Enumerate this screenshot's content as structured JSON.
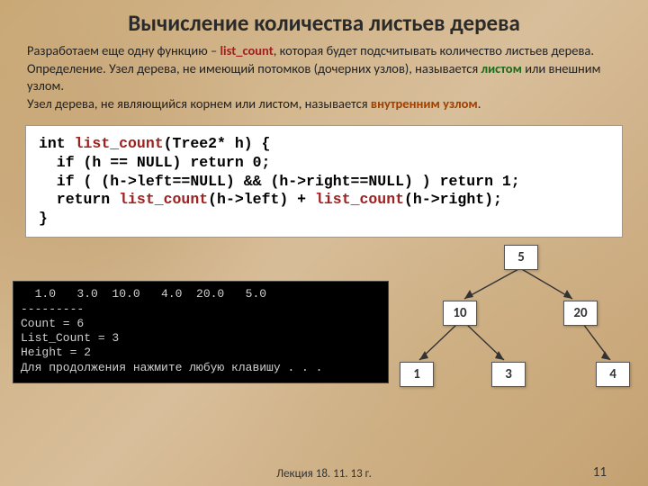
{
  "title": "Вычисление количества листьев дерева",
  "intro": {
    "p1a": "Разработаем еще одну функцию – ",
    "fn": "list_count",
    "p1b": ", которая будет подсчитывать количество листьев дерева.",
    "p2a": "Определение. Узел дерева, не имеющий потомков (дочерних узлов), называется ",
    "leaf": "листом",
    "p2b": " или внешним узлом.",
    "p3a": "Узел дерева, не являющийся корнем или листом, называется ",
    "inner": "внутренним узлом",
    "p3b": "."
  },
  "code": {
    "l1a": "int ",
    "l1fn": "list_count",
    "l1b": "(Tree2* h) {",
    "l2": "  if (h == NULL) return 0;",
    "l3": "  if ( (h->left==NULL) && (h->right==NULL) ) return 1;",
    "l4a": "  return ",
    "l4fn1": "list_count",
    "l4b": "(h->left) + ",
    "l4fn2": "list_count",
    "l4c": "(h->right);",
    "l5": "}"
  },
  "console": {
    "row": "  1.0   3.0  10.0   4.0  20.0   5.0",
    "dashes": "---------",
    "count": "Count = 6",
    "lcount": "List_Count = 3",
    "height": "Height = 2",
    "press": "Для продолжения нажмите любую клавишу . . ."
  },
  "tree": {
    "n5": "5",
    "n10": "10",
    "n20": "20",
    "n1": "1",
    "n3": "3",
    "n4": "4"
  },
  "footer": "Лекция  18. 11. 13 г.",
  "pagenum": "11",
  "chart_data": {
    "type": "table",
    "title": "Tree structure and traversal output",
    "tree_edges": [
      [
        "5",
        "10"
      ],
      [
        "5",
        "20"
      ],
      [
        "10",
        "1"
      ],
      [
        "10",
        "3"
      ],
      [
        "20",
        "4"
      ]
    ],
    "tree_nodes": [
      "5",
      "10",
      "20",
      "1",
      "3",
      "4"
    ],
    "input_values": [
      1.0,
      3.0,
      10.0,
      4.0,
      20.0,
      5.0
    ],
    "Count": 6,
    "List_Count": 3,
    "Height": 2
  }
}
